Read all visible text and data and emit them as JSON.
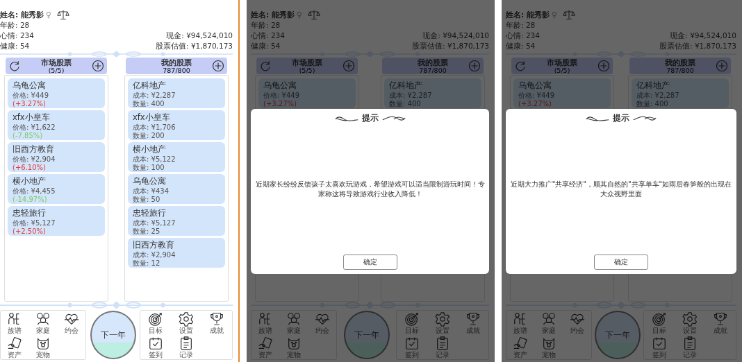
{
  "screens": [
    {
      "profile": {
        "name": "姓名: 能秀影",
        "gender": "♀",
        "age": "年龄: 28",
        "mood": "心情: 234",
        "health": "健康: 54",
        "cash": "现金: ¥94,524,010",
        "stock_value": "股票估值: ¥1,870,173"
      },
      "market": {
        "title": "市场股票",
        "count": "(5/5)",
        "stocks": [
          {
            "name": "乌龟公寓",
            "price": "价格: ¥449",
            "change": "(+3.27%)",
            "color": "#e53935"
          },
          {
            "name": "xfx小皇车",
            "price": "价格: ¥1,622",
            "change": "(-7.85%)",
            "color": "#7cc96a"
          },
          {
            "name": "旧西方教育",
            "price": "价格: ¥2,904",
            "change": "(+6.10%)",
            "color": "#e53935"
          },
          {
            "name": "横小地产",
            "price": "价格: ¥4,455",
            "change": "(-14.97%)",
            "color": "#7cc96a"
          },
          {
            "name": "忠轻旅行",
            "price": "价格: ¥5,127",
            "change": "(+2.50%)",
            "color": "#e53935"
          }
        ]
      },
      "portfolio": {
        "title": "我的股票",
        "count": "787/800",
        "stocks": [
          {
            "name": "亿科地产",
            "cost": "成本: ¥2,287",
            "quantity": "数量: 400"
          },
          {
            "name": "xfx小皇车",
            "cost": "成本: ¥1,706",
            "quantity": "数量: 200"
          },
          {
            "name": "横小地产",
            "cost": "成本: ¥5,122",
            "quantity": "数量: 100"
          },
          {
            "name": "乌龟公寓",
            "cost": "成本: ¥434",
            "quantity": "数量: 50"
          },
          {
            "name": "忠轻旅行",
            "cost": "成本: ¥5,127",
            "quantity": "数量: 25"
          },
          {
            "name": "旧西方教育",
            "cost": "成本: ¥2,904",
            "quantity": "数量: 12"
          }
        ]
      },
      "nav": {
        "left": [
          "族谱",
          "家庭",
          "约会",
          "资产",
          "宠物"
        ],
        "next_button": "下一年",
        "right": [
          "目标",
          "设置",
          "成就",
          "签到",
          "记录"
        ]
      }
    },
    {
      "profile": {
        "name": "姓名: 能秀影",
        "gender": "♀",
        "age": "年龄: 28",
        "mood": "心情: 234",
        "health": "健康: 54",
        "cash": "现金: ¥94,524,010",
        "stock_value": "股票估值: ¥1,870,173"
      },
      "market": {
        "title": "市场股票",
        "count": "(5/5)",
        "stocks": [
          {
            "name": "乌龟公寓",
            "price": "价格: ¥449",
            "change": "(+3.27%)",
            "color": "#5c1716"
          }
        ]
      },
      "portfolio": {
        "title": "我的股票",
        "count": "787/800",
        "stocks": [
          {
            "name": "亿科地产",
            "cost": "成本: ¥2,287",
            "quantity": "数量: 400"
          }
        ]
      },
      "nav": {
        "left": [
          "族谱",
          "家庭",
          "约会",
          "资产",
          "宠物"
        ],
        "next_button": "下一年",
        "right": [
          "目标",
          "设置",
          "成就",
          "签到",
          "记录"
        ]
      },
      "dialog": {
        "title": "提示",
        "message": "近期家长纷纷反馈孩子太喜欢玩游戏，希望游戏可以适当限制游玩时间！专家称这将导致游戏行业收入降低！",
        "button": "确定"
      }
    },
    {
      "profile": {
        "name": "姓名: 能秀影",
        "gender": "♀",
        "age": "年龄: 28",
        "mood": "心情: 234",
        "health": "健康: 54",
        "cash": "现金: ¥94,524,010",
        "stock_value": "股票估值: ¥1,870,173"
      },
      "market": {
        "title": "市场股票",
        "count": "(5/5)",
        "stocks": [
          {
            "name": "乌龟公寓",
            "price": "价格: ¥449",
            "change": "(+3.27%)",
            "color": "#5c1716"
          }
        ]
      },
      "portfolio": {
        "title": "我的股票",
        "count": "787/800",
        "stocks": [
          {
            "name": "亿科地产",
            "cost": "成本: ¥2,287",
            "quantity": "数量: 400"
          }
        ]
      },
      "nav": {
        "left": [
          "族谱",
          "家庭",
          "约会",
          "资产",
          "宠物"
        ],
        "next_button": "下一年",
        "right": [
          "目标",
          "设置",
          "成就",
          "签到",
          "记录"
        ]
      },
      "dialog": {
        "title": "提示",
        "message": "近期大力推广\"共享经济\"，顺其自然的\"共享单车\"如雨后春笋般的出现在大众视野里面",
        "button": "确定"
      }
    }
  ]
}
